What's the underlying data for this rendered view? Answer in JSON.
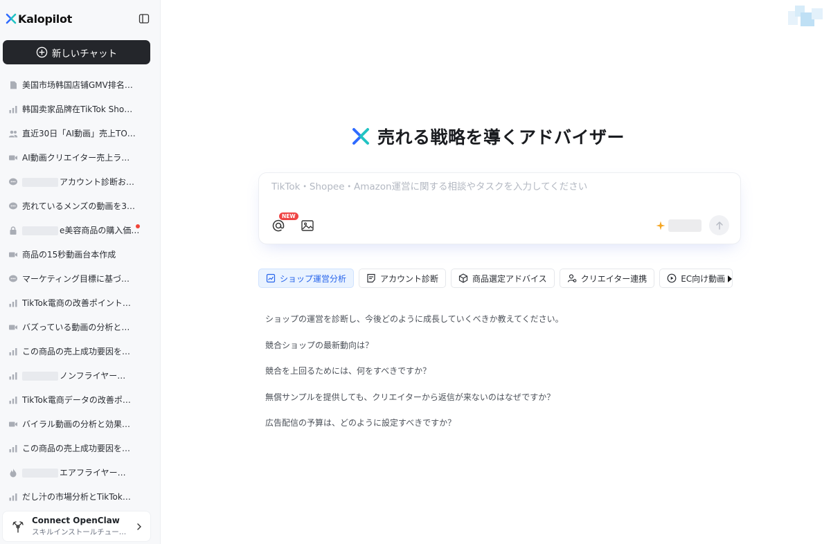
{
  "brand": {
    "name": "Kalopilot"
  },
  "sidebar": {
    "new_chat_label": "新しいチャット",
    "history": [
      {
        "icon": "document-icon",
        "text": "美国市场韩国店铺GMV排名…"
      },
      {
        "icon": "bar-chart-icon",
        "text": "韩国卖家品牌在TikTok Sho…"
      },
      {
        "icon": "users-icon",
        "text": "直近30日「AI動画」売上TO…"
      },
      {
        "icon": "video-icon",
        "text": "AI動画クリエイター売上ラ…"
      },
      {
        "icon": "chat-bubble-icon",
        "text": "アカウント診断お…",
        "redacted": true
      },
      {
        "icon": "chat-bubble-icon",
        "text": "売れているメンズの動画を3…"
      },
      {
        "icon": "lock-icon",
        "text": "e美容商品の購入価値…",
        "redacted": true,
        "dot": true
      },
      {
        "icon": "video-icon",
        "text": "商品の15秒動画台本作成"
      },
      {
        "icon": "chat-bubble-icon",
        "text": "マーケティング目標に基づ…"
      },
      {
        "icon": "bar-chart-icon",
        "text": "TikTok電商の改善ポイント…"
      },
      {
        "icon": "video-icon",
        "text": "バズっている動画の分析と…"
      },
      {
        "icon": "bar-chart-icon",
        "text": "この商品の売上成功要因を…"
      },
      {
        "icon": "bar-chart-icon",
        "text": "ノンフライヤー…",
        "redacted": true
      },
      {
        "icon": "bar-chart-icon",
        "text": "TikTok電商データの改善ポ…"
      },
      {
        "icon": "video-icon",
        "text": "バイラル動画の分析と効果…"
      },
      {
        "icon": "bar-chart-icon",
        "text": "この商品の売上成功要因を…"
      },
      {
        "icon": "flame-icon",
        "text": "エアフライヤー…",
        "redacted": true
      },
      {
        "icon": "bar-chart-icon",
        "text": "だし汁の市場分析とTikTok…"
      }
    ],
    "openclaw": {
      "title": "Connect OpenClaw",
      "subtitle": "スキルインストールチュートリアル"
    }
  },
  "main": {
    "hero_title": "売れる戦略を導くアドバイザー",
    "composer": {
      "placeholder": "TikTok・Shopee・Amazon運営に関する相談やタスクを入力してください",
      "value": "",
      "new_badge": "NEW"
    },
    "chips": [
      {
        "icon": "chart-image-icon",
        "label": "ショップ運営分析",
        "active": true
      },
      {
        "icon": "note-icon",
        "label": "アカウント診断",
        "active": false
      },
      {
        "icon": "box-icon",
        "label": "商品選定アドバイス",
        "active": false
      },
      {
        "icon": "user-link-icon",
        "label": "クリエイター連携",
        "active": false
      },
      {
        "icon": "play-circle-icon",
        "label": "EC向け動画",
        "active": false
      }
    ],
    "suggestions": [
      "ショップの運営を診断し、今後どのように成長していくべきか教えてください。",
      "競合ショップの最新動向は？",
      "競合を上回るためには、何をすべきですか？",
      "無償サンプルを提供しても、クリエイターから返信が来ないのはなぜですか？",
      "広告配信の予算は、どのように設定すべきですか？"
    ]
  },
  "colors": {
    "accent": "#2563eb",
    "logo_blue": "#2f6bff",
    "logo_teal": "#22c3c3",
    "dark_button": "#24262b"
  }
}
